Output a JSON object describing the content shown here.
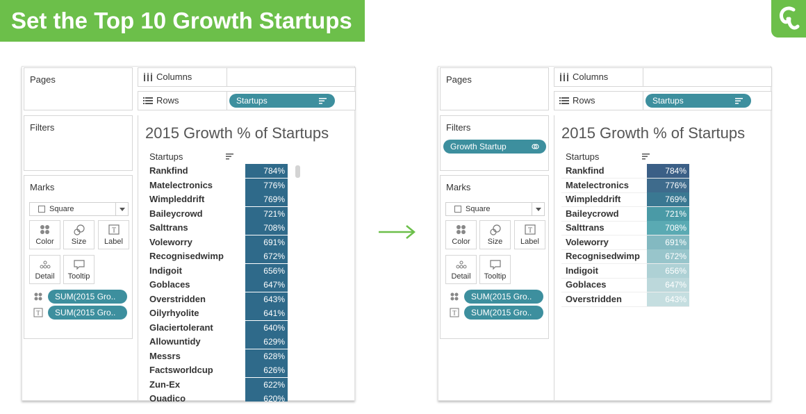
{
  "banner": {
    "title": "Set the Top 10 Growth Startups"
  },
  "colors": {
    "banner": "#6cbf4a",
    "pill": "#3d8f9e",
    "bar_dark": "#2f6a8a"
  },
  "icons": [
    "logo-icon",
    "arrow-right-icon",
    "columns-icon",
    "rows-icon",
    "sort-icon",
    "color-icon",
    "size-icon",
    "label-icon",
    "detail-icon",
    "tooltip-icon",
    "filter-link-icon",
    "scroll-bar"
  ],
  "left": {
    "pages_label": "Pages",
    "filters_label": "Filters",
    "marks_label": "Marks",
    "columns_label": "Columns",
    "rows_label": "Rows",
    "rows_pill": "Startups",
    "mark_type": "Square",
    "buttons": [
      "Color",
      "Size",
      "Label",
      "Detail",
      "Tooltip"
    ],
    "mark_pills": [
      "SUM(2015 Gro..",
      "SUM(2015 Gro.."
    ],
    "viz_title": "2015 Growth % of Startups",
    "col_header": "Startups",
    "rows": [
      {
        "name": "Rankfind",
        "value": "784%"
      },
      {
        "name": "Matelectronics",
        "value": "776%"
      },
      {
        "name": "Wimpleddrift",
        "value": "769%"
      },
      {
        "name": "Baileycrowd",
        "value": "721%"
      },
      {
        "name": "Salttrans",
        "value": "708%"
      },
      {
        "name": "Voleworry",
        "value": "691%"
      },
      {
        "name": "Recognisedwimp",
        "value": "672%"
      },
      {
        "name": "Indigoit",
        "value": "656%"
      },
      {
        "name": "Goblaces",
        "value": "647%"
      },
      {
        "name": "Overstridden",
        "value": "643%"
      },
      {
        "name": "Oilyrhyolite",
        "value": "641%"
      },
      {
        "name": "Glaciertolerant",
        "value": "640%"
      },
      {
        "name": "Allowuntidy",
        "value": "629%"
      },
      {
        "name": "Messrs",
        "value": "628%"
      },
      {
        "name": "Factsworldcup",
        "value": "626%"
      },
      {
        "name": "Zun-Ex",
        "value": "622%"
      },
      {
        "name": "Quadico",
        "value": "620%"
      }
    ]
  },
  "right": {
    "pages_label": "Pages",
    "filters_label": "Filters",
    "filter_pill": "Growth Startup",
    "marks_label": "Marks",
    "columns_label": "Columns",
    "rows_label": "Rows",
    "rows_pill": "Startups",
    "mark_type": "Square",
    "buttons": [
      "Color",
      "Size",
      "Label",
      "Detail",
      "Tooltip"
    ],
    "mark_pills": [
      "SUM(2015 Gro..",
      "SUM(2015 Gro.."
    ],
    "viz_title": "2015 Growth % of Startups",
    "col_header": "Startups",
    "rows": [
      {
        "name": "Rankfind",
        "value": "784%",
        "color": "#3b5f86"
      },
      {
        "name": "Matelectronics",
        "value": "776%",
        "color": "#3e6b8c"
      },
      {
        "name": "Wimpleddrift",
        "value": "769%",
        "color": "#3a7892"
      },
      {
        "name": "Baileycrowd",
        "value": "721%",
        "color": "#4a9aa6"
      },
      {
        "name": "Salttrans",
        "value": "708%",
        "color": "#5aaab3"
      },
      {
        "name": "Voleworry",
        "value": "691%",
        "color": "#83b9c1"
      },
      {
        "name": "Recognisedwimp",
        "value": "672%",
        "color": "#98c5cb"
      },
      {
        "name": "Indigoit",
        "value": "656%",
        "color": "#aed1d5"
      },
      {
        "name": "Goblaces",
        "value": "647%",
        "color": "#bcd8db"
      },
      {
        "name": "Overstridden",
        "value": "643%",
        "color": "#c5dee0"
      }
    ]
  }
}
